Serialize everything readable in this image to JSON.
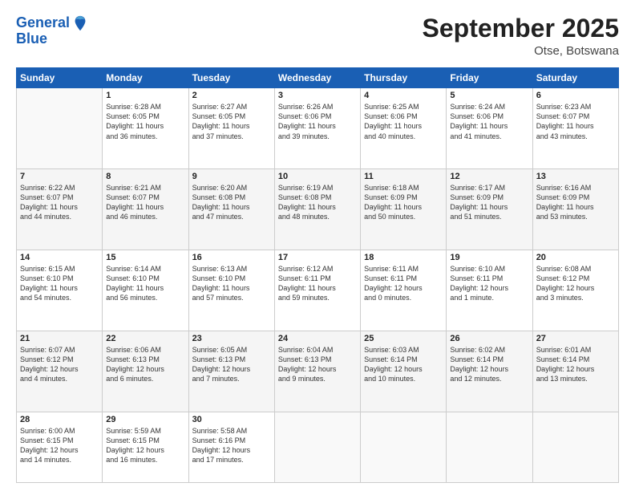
{
  "header": {
    "logo_line1": "General",
    "logo_line2": "Blue",
    "month_year": "September 2025",
    "location": "Otse, Botswana"
  },
  "columns": [
    "Sunday",
    "Monday",
    "Tuesday",
    "Wednesday",
    "Thursday",
    "Friday",
    "Saturday"
  ],
  "weeks": [
    [
      {
        "day": "",
        "info": ""
      },
      {
        "day": "1",
        "info": "Sunrise: 6:28 AM\nSunset: 6:05 PM\nDaylight: 11 hours\nand 36 minutes."
      },
      {
        "day": "2",
        "info": "Sunrise: 6:27 AM\nSunset: 6:05 PM\nDaylight: 11 hours\nand 37 minutes."
      },
      {
        "day": "3",
        "info": "Sunrise: 6:26 AM\nSunset: 6:06 PM\nDaylight: 11 hours\nand 39 minutes."
      },
      {
        "day": "4",
        "info": "Sunrise: 6:25 AM\nSunset: 6:06 PM\nDaylight: 11 hours\nand 40 minutes."
      },
      {
        "day": "5",
        "info": "Sunrise: 6:24 AM\nSunset: 6:06 PM\nDaylight: 11 hours\nand 41 minutes."
      },
      {
        "day": "6",
        "info": "Sunrise: 6:23 AM\nSunset: 6:07 PM\nDaylight: 11 hours\nand 43 minutes."
      }
    ],
    [
      {
        "day": "7",
        "info": "Sunrise: 6:22 AM\nSunset: 6:07 PM\nDaylight: 11 hours\nand 44 minutes."
      },
      {
        "day": "8",
        "info": "Sunrise: 6:21 AM\nSunset: 6:07 PM\nDaylight: 11 hours\nand 46 minutes."
      },
      {
        "day": "9",
        "info": "Sunrise: 6:20 AM\nSunset: 6:08 PM\nDaylight: 11 hours\nand 47 minutes."
      },
      {
        "day": "10",
        "info": "Sunrise: 6:19 AM\nSunset: 6:08 PM\nDaylight: 11 hours\nand 48 minutes."
      },
      {
        "day": "11",
        "info": "Sunrise: 6:18 AM\nSunset: 6:09 PM\nDaylight: 11 hours\nand 50 minutes."
      },
      {
        "day": "12",
        "info": "Sunrise: 6:17 AM\nSunset: 6:09 PM\nDaylight: 11 hours\nand 51 minutes."
      },
      {
        "day": "13",
        "info": "Sunrise: 6:16 AM\nSunset: 6:09 PM\nDaylight: 11 hours\nand 53 minutes."
      }
    ],
    [
      {
        "day": "14",
        "info": "Sunrise: 6:15 AM\nSunset: 6:10 PM\nDaylight: 11 hours\nand 54 minutes."
      },
      {
        "day": "15",
        "info": "Sunrise: 6:14 AM\nSunset: 6:10 PM\nDaylight: 11 hours\nand 56 minutes."
      },
      {
        "day": "16",
        "info": "Sunrise: 6:13 AM\nSunset: 6:10 PM\nDaylight: 11 hours\nand 57 minutes."
      },
      {
        "day": "17",
        "info": "Sunrise: 6:12 AM\nSunset: 6:11 PM\nDaylight: 11 hours\nand 59 minutes."
      },
      {
        "day": "18",
        "info": "Sunrise: 6:11 AM\nSunset: 6:11 PM\nDaylight: 12 hours\nand 0 minutes."
      },
      {
        "day": "19",
        "info": "Sunrise: 6:10 AM\nSunset: 6:11 PM\nDaylight: 12 hours\nand 1 minute."
      },
      {
        "day": "20",
        "info": "Sunrise: 6:08 AM\nSunset: 6:12 PM\nDaylight: 12 hours\nand 3 minutes."
      }
    ],
    [
      {
        "day": "21",
        "info": "Sunrise: 6:07 AM\nSunset: 6:12 PM\nDaylight: 12 hours\nand 4 minutes."
      },
      {
        "day": "22",
        "info": "Sunrise: 6:06 AM\nSunset: 6:13 PM\nDaylight: 12 hours\nand 6 minutes."
      },
      {
        "day": "23",
        "info": "Sunrise: 6:05 AM\nSunset: 6:13 PM\nDaylight: 12 hours\nand 7 minutes."
      },
      {
        "day": "24",
        "info": "Sunrise: 6:04 AM\nSunset: 6:13 PM\nDaylight: 12 hours\nand 9 minutes."
      },
      {
        "day": "25",
        "info": "Sunrise: 6:03 AM\nSunset: 6:14 PM\nDaylight: 12 hours\nand 10 minutes."
      },
      {
        "day": "26",
        "info": "Sunrise: 6:02 AM\nSunset: 6:14 PM\nDaylight: 12 hours\nand 12 minutes."
      },
      {
        "day": "27",
        "info": "Sunrise: 6:01 AM\nSunset: 6:14 PM\nDaylight: 12 hours\nand 13 minutes."
      }
    ],
    [
      {
        "day": "28",
        "info": "Sunrise: 6:00 AM\nSunset: 6:15 PM\nDaylight: 12 hours\nand 14 minutes."
      },
      {
        "day": "29",
        "info": "Sunrise: 5:59 AM\nSunset: 6:15 PM\nDaylight: 12 hours\nand 16 minutes."
      },
      {
        "day": "30",
        "info": "Sunrise: 5:58 AM\nSunset: 6:16 PM\nDaylight: 12 hours\nand 17 minutes."
      },
      {
        "day": "",
        "info": ""
      },
      {
        "day": "",
        "info": ""
      },
      {
        "day": "",
        "info": ""
      },
      {
        "day": "",
        "info": ""
      }
    ]
  ]
}
